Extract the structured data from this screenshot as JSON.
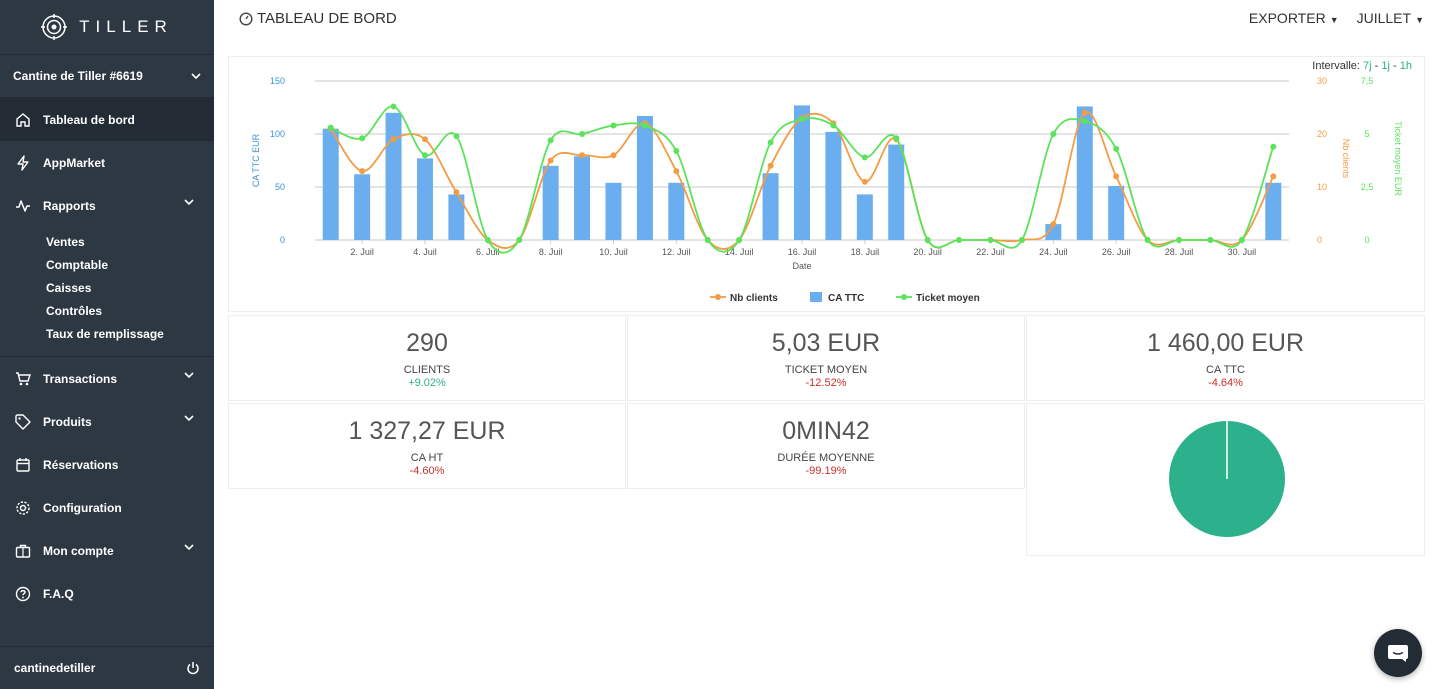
{
  "brand": {
    "name": "TILLER"
  },
  "sidebar": {
    "store": "Cantine de Tiller #6619",
    "items": [
      {
        "label": "Tableau de bord"
      },
      {
        "label": "AppMarket"
      },
      {
        "label": "Rapports"
      },
      {
        "label": "Transactions"
      },
      {
        "label": "Produits"
      },
      {
        "label": "Réservations"
      },
      {
        "label": "Configuration"
      },
      {
        "label": "Mon compte"
      },
      {
        "label": "F.A.Q"
      }
    ],
    "reports_sub": [
      "Ventes",
      "Comptable",
      "Caisses",
      "Contrôles",
      "Taux de remplissage"
    ],
    "user": "cantinedetiller"
  },
  "header": {
    "title": "TABLEAU DE BORD",
    "export_label": "EXPORTER",
    "month_label": "JUILLET"
  },
  "intervalle": {
    "label": "Intervalle:",
    "options": [
      "7j",
      "1j",
      "1h"
    ],
    "sep": "-"
  },
  "chart_data": {
    "type": "bar",
    "xlabel": "Date",
    "categories": [
      "1",
      "2",
      "3",
      "4",
      "5",
      "6",
      "7",
      "8",
      "9",
      "10",
      "11",
      "12",
      "13",
      "14",
      "15",
      "16",
      "17",
      "18",
      "19",
      "20",
      "21",
      "22",
      "23",
      "24",
      "25",
      "26",
      "27",
      "28",
      "29",
      "30",
      "31"
    ],
    "x_tick_labels": [
      "2. Juil",
      "4. Juil",
      "6. Juil",
      "8. Juil",
      "10. Juil",
      "12. Juil",
      "14. Juil",
      "16. Juil",
      "18. Juil",
      "20. Juil",
      "22. Juil",
      "24. Juil",
      "26. Juil",
      "28. Juil",
      "30. Juil"
    ],
    "series": [
      {
        "name": "CA TTC",
        "type": "bar",
        "axis": "CA TTC EUR",
        "color": "#6aaef0",
        "values": [
          105,
          62,
          120,
          77,
          43,
          0,
          0,
          70,
          79,
          54,
          117,
          54,
          0,
          0,
          63,
          127,
          102,
          43,
          90,
          0,
          0,
          0,
          0,
          15,
          126,
          51,
          0,
          0,
          0,
          0,
          54
        ]
      },
      {
        "name": "Nb clients",
        "type": "line",
        "axis": "Nb clients",
        "color": "#f39c46",
        "values": [
          21,
          13,
          19,
          19,
          9,
          0,
          0,
          15,
          16,
          16,
          22,
          13,
          0,
          0,
          14,
          23,
          22,
          11,
          19,
          0,
          0,
          0,
          0,
          3,
          24,
          12,
          0,
          0,
          0,
          0,
          12
        ]
      },
      {
        "name": "Ticket moyen",
        "type": "line",
        "axis": "Ticket moyen EUR",
        "color": "#5be35b",
        "values": [
          5.3,
          4.8,
          6.3,
          4.0,
          4.9,
          0,
          0,
          4.7,
          5.0,
          5.4,
          5.4,
          4.2,
          0,
          0,
          4.6,
          5.7,
          5.4,
          3.9,
          4.8,
          0,
          0,
          0,
          0,
          5.0,
          5.6,
          4.3,
          0,
          0,
          0,
          0,
          4.4
        ]
      }
    ],
    "axes": {
      "left": {
        "label": "CA TTC EUR",
        "ylim": [
          0,
          150
        ],
        "ticks": [
          "0",
          "50",
          "100",
          "150"
        ],
        "color": "#3a93d5"
      },
      "right1": {
        "label": "Nb clients",
        "ylim": [
          0,
          30
        ],
        "ticks": [
          "0",
          "10",
          "20",
          "30"
        ],
        "color": "#f39c46"
      },
      "right2": {
        "label": "Ticket moyen EUR",
        "ylim": [
          0,
          7.5
        ],
        "ticks": [
          "0",
          "2,5",
          "5",
          "7,5"
        ],
        "color": "#5be35b"
      }
    },
    "legend": {
      "placement": "bottom-center",
      "entries": [
        "Nb clients",
        "CA TTC",
        "Ticket moyen"
      ]
    }
  },
  "stats": [
    {
      "value": "290",
      "label": "CLIENTS",
      "delta": "+9.02%",
      "trend": "up"
    },
    {
      "value": "5,03 EUR",
      "label": "TICKET MOYEN",
      "delta": "-12.52%",
      "trend": "down"
    },
    {
      "value": "1 460,00 EUR",
      "label": "CA TTC",
      "delta": "-4.64%",
      "trend": "down"
    },
    {
      "value": "1 327,27 EUR",
      "label": "CA HT",
      "delta": "-4.60%",
      "trend": "down"
    },
    {
      "value": "0MIN42",
      "label": "DURÉE MOYENNE",
      "delta": "-99.19%",
      "trend": "down"
    }
  ],
  "pie": {
    "color": "#2cb18c"
  }
}
